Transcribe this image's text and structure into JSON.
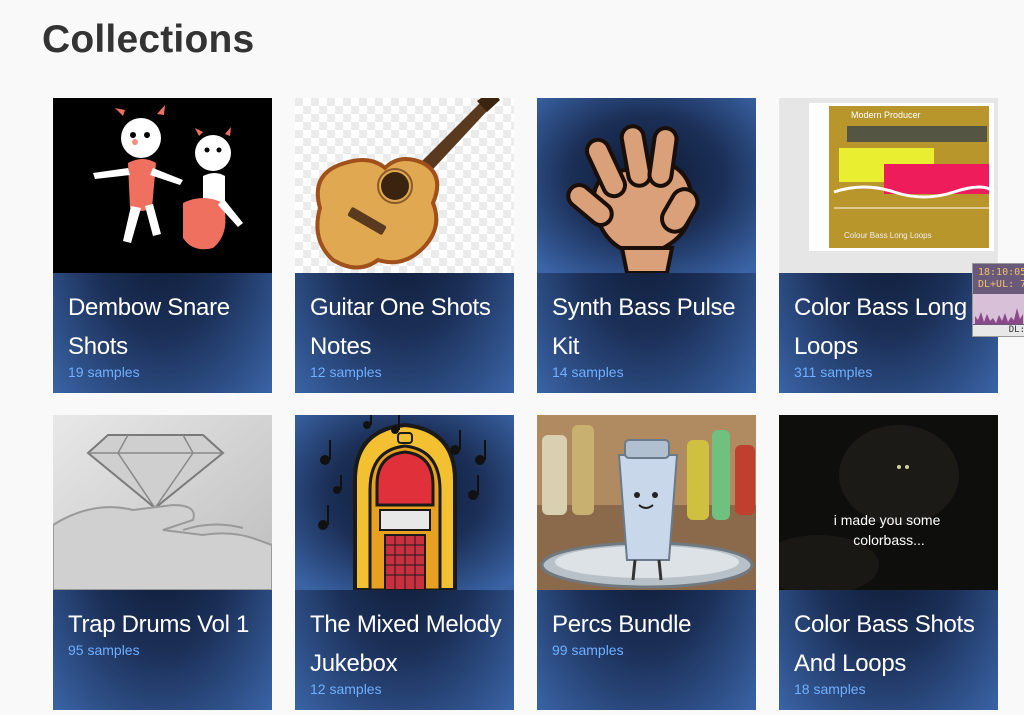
{
  "page": {
    "title": "Collections"
  },
  "collections": [
    {
      "title": "Dembow Snare Shots",
      "count": "19 samples",
      "thumb": "cartoon-dancers"
    },
    {
      "title": "Guitar One Shots Notes",
      "count": "12 samples",
      "thumb": "acoustic-guitar"
    },
    {
      "title": "Synth Bass Pulse Kit",
      "count": "14 samples",
      "thumb": "cartoon-hand"
    },
    {
      "title": "Color Bass Long Loops",
      "count": "311 samples",
      "thumb": "waveform-cover"
    },
    {
      "title": "Trap Drums Vol 1",
      "count": "95 samples",
      "thumb": "diamond-hand"
    },
    {
      "title": "The Mixed Melody Jukebox",
      "count": "12 samples",
      "thumb": "jukebox"
    },
    {
      "title": "Percs Bundle",
      "count": "99 samples",
      "thumb": "cocktail-shaker"
    },
    {
      "title": "Color Bass Shots And Loops",
      "count": "18 samples",
      "thumb": "dark-meme",
      "thumb_caption": "i made you some colorbass..."
    }
  ],
  "thumb_texts": {
    "waveform_cover_top": "Modern Producer",
    "waveform_cover_bottom": "Colour Bass Long Loops"
  },
  "netmon": {
    "line1": "18:10:05",
    "line2": "DL+UL: 7",
    "line3": "DL:"
  },
  "colors": {
    "card_edge": "#3a64a6",
    "card_center": "#0d1a33",
    "count_text": "#6fb0ff",
    "heading": "#333333"
  }
}
